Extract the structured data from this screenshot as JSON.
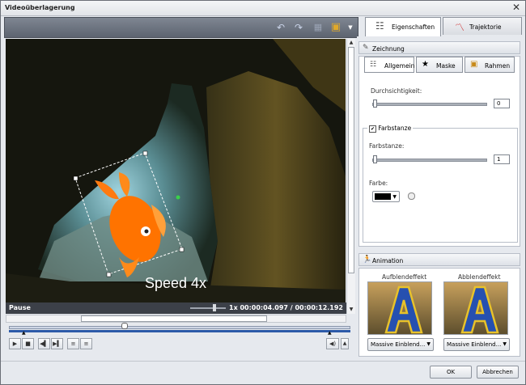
{
  "window": {
    "title": "Videoüberlagerung",
    "close_glyph": "✕"
  },
  "toolbar": {
    "icons": [
      "undo-icon",
      "redo-icon",
      "grid-icon",
      "display-icon",
      "chevron-down-icon"
    ]
  },
  "video": {
    "overlay_text": "Speed 4x",
    "status": "Pause",
    "speed": "1x",
    "time": "00:00:04.097 / 00:00:12.192"
  },
  "tabs": [
    {
      "label": "Eigenschaften",
      "icon": "properties-icon",
      "active": true
    },
    {
      "label": "Trajektorie",
      "icon": "trajectory-icon",
      "active": false
    }
  ],
  "drawing": {
    "header": "Zeichnung",
    "subtabs": [
      "Allgemein",
      "Maske",
      "Rahmen"
    ],
    "opacity_label": "Durchsichtigkeit:",
    "opacity_value": "0",
    "colorkey_checkbox": "Farbstanze",
    "colorkey_checked": true,
    "colorkey_label": "Farbstanze:",
    "colorkey_value": "1",
    "color_label": "Farbe:",
    "color_value": "#000000"
  },
  "animation": {
    "header": "Animation",
    "fade_in_label": "Aufblendeffekt",
    "fade_out_label": "Abblendeffekt",
    "fade_in_value": "Massive Einblend...",
    "fade_out_value": "Massive Einblend..."
  },
  "footer": {
    "ok": "OK",
    "cancel": "Abbrechen"
  }
}
